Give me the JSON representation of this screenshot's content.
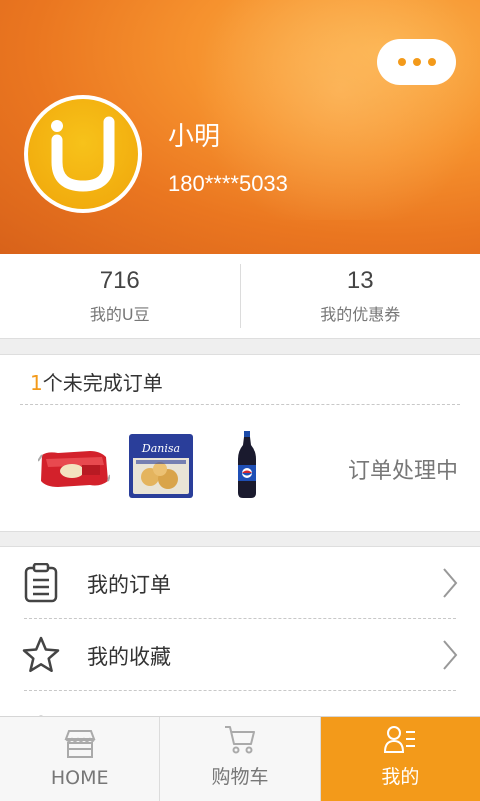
{
  "profile": {
    "name": "小明",
    "phone": "180****5033",
    "avatar_icon": "brand-u-logo-icon",
    "more_icon": "more-dots-icon"
  },
  "stats": [
    {
      "value": "716",
      "label": "我的U豆"
    },
    {
      "value": "13",
      "label": "我的优惠券"
    }
  ],
  "orders": {
    "count": "1",
    "title_suffix": "个未完成订单",
    "status": "订单处理中",
    "products": [
      {
        "icon": "candy-pack-image"
      },
      {
        "icon": "danisa-cookies-image"
      },
      {
        "icon": "pepsi-bottle-image"
      }
    ]
  },
  "menu": [
    {
      "label": "我的订单",
      "icon": "clipboard-icon"
    },
    {
      "label": "我的收藏",
      "icon": "star-icon"
    }
  ],
  "tabbar": {
    "tabs": [
      {
        "label": "HOME",
        "icon": "store-icon"
      },
      {
        "label": "购物车",
        "icon": "cart-icon"
      },
      {
        "label": "我的",
        "icon": "profile-list-icon"
      }
    ],
    "active_index": 2
  },
  "colors": {
    "accent": "#f39a1a",
    "header_gradient_start": "#d8621a",
    "header_gradient_end": "#fbb04a"
  }
}
